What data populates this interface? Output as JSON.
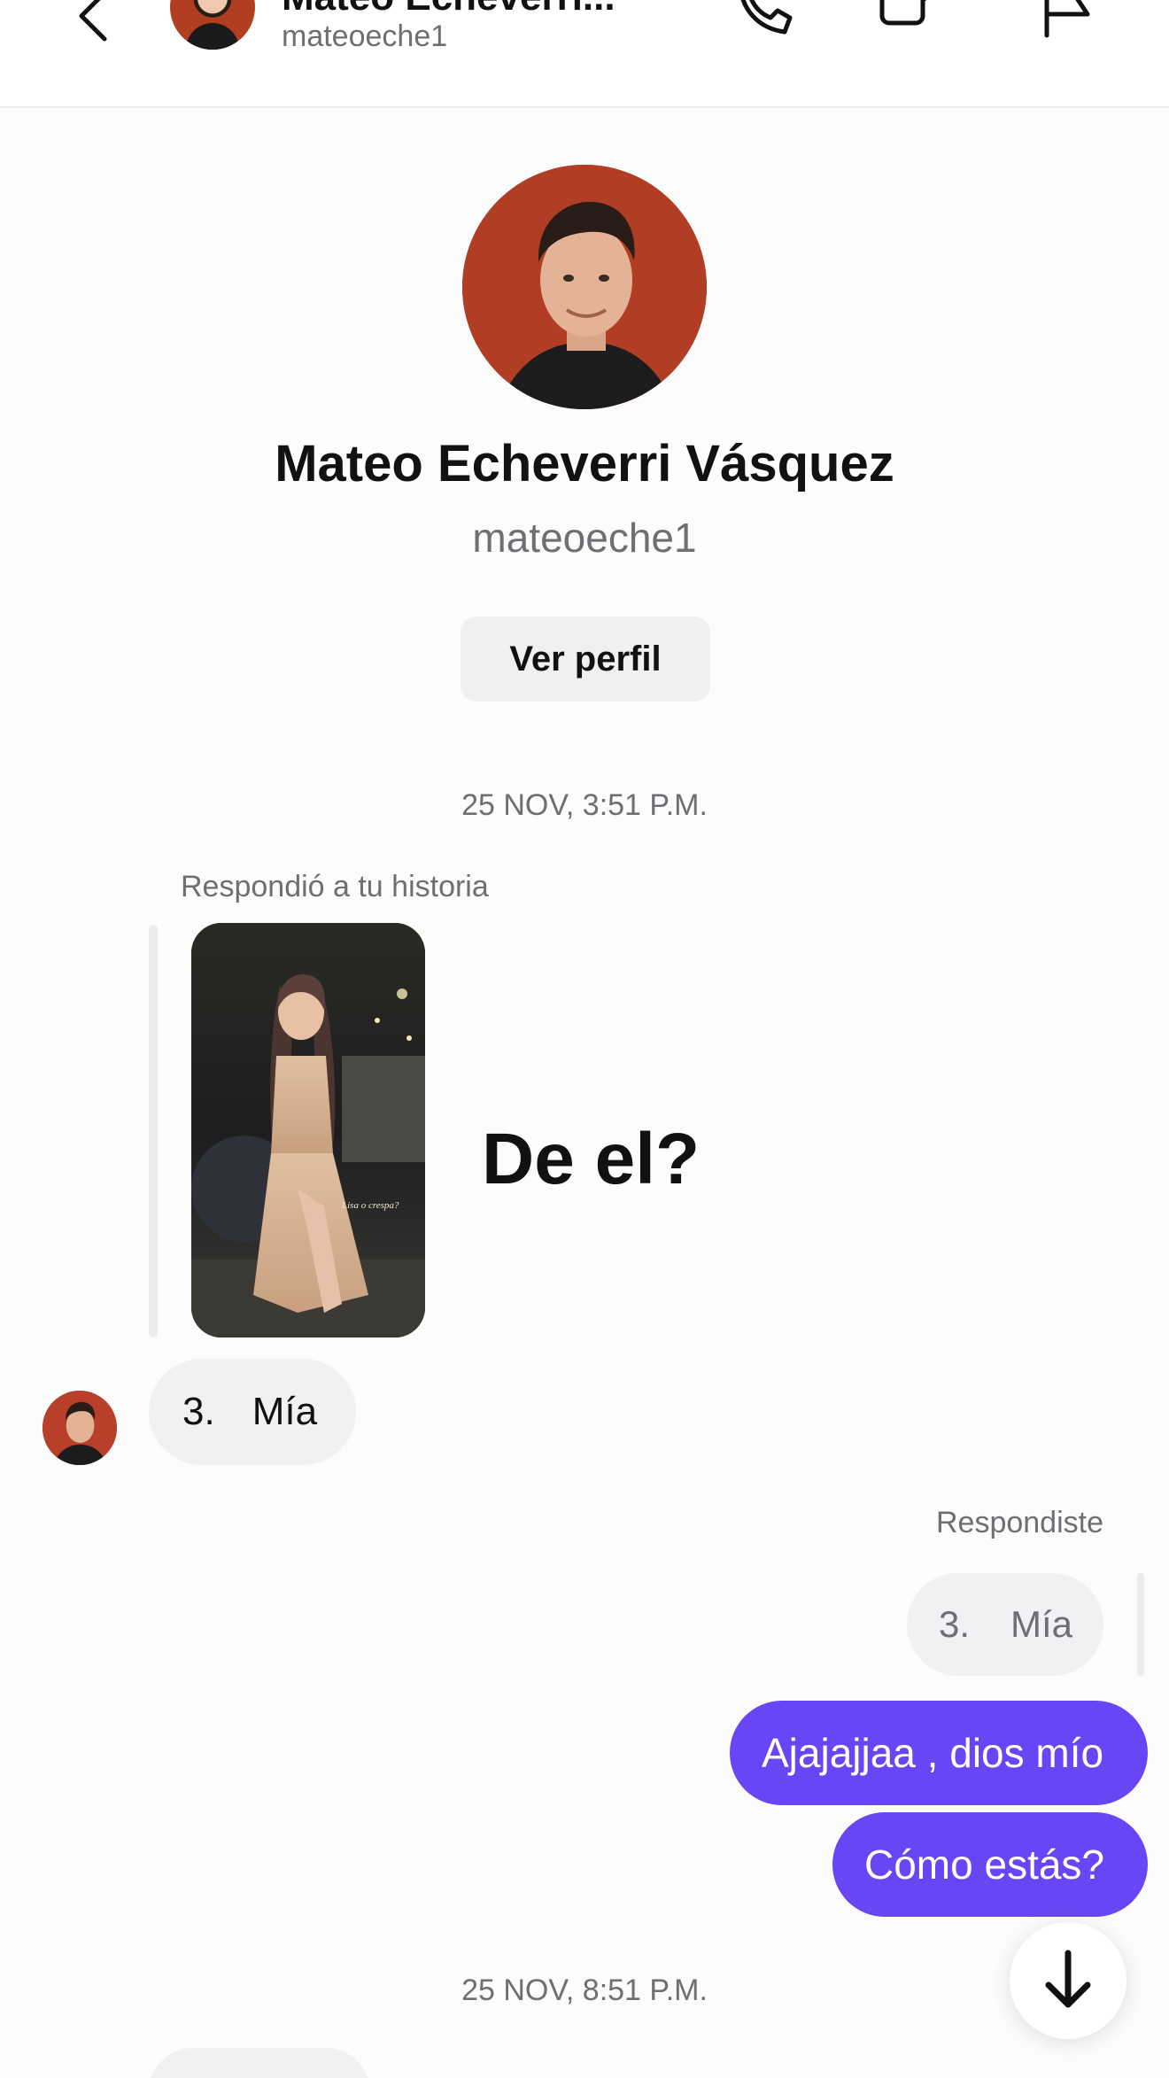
{
  "header": {
    "name": "Mateo Echeverri...",
    "username": "mateoeche1"
  },
  "profile": {
    "name": "Mateo Echeverri Vásquez",
    "username": "mateoeche1",
    "view_profile_label": "Ver perfil"
  },
  "conversation": {
    "timestamp_1": "25 NOV, 3:51 P.M.",
    "story_reply_label": "Respondió a tu historia",
    "story_reply_text": "De el?",
    "story_caption": "Lisa o crespa?",
    "incoming_1": {
      "number": "3.",
      "text": "Mía"
    },
    "you_replied_label": "Respondiste",
    "quoted": {
      "number": "3.",
      "text": "Mía"
    },
    "outgoing_1": "Ajajajjaa , dios mío",
    "outgoing_2": "Cómo estás?",
    "timestamp_2": "25 NOV, 8:51 P.M."
  },
  "colors": {
    "accent": "#6846f5",
    "bubble_in": "#eff1f3",
    "muted_text": "#6e6e73"
  },
  "icons": {
    "back": "chevron-left-icon",
    "call": "phone-icon",
    "video": "video-camera-icon",
    "report": "flag-icon",
    "scroll_down": "arrow-down-icon"
  }
}
